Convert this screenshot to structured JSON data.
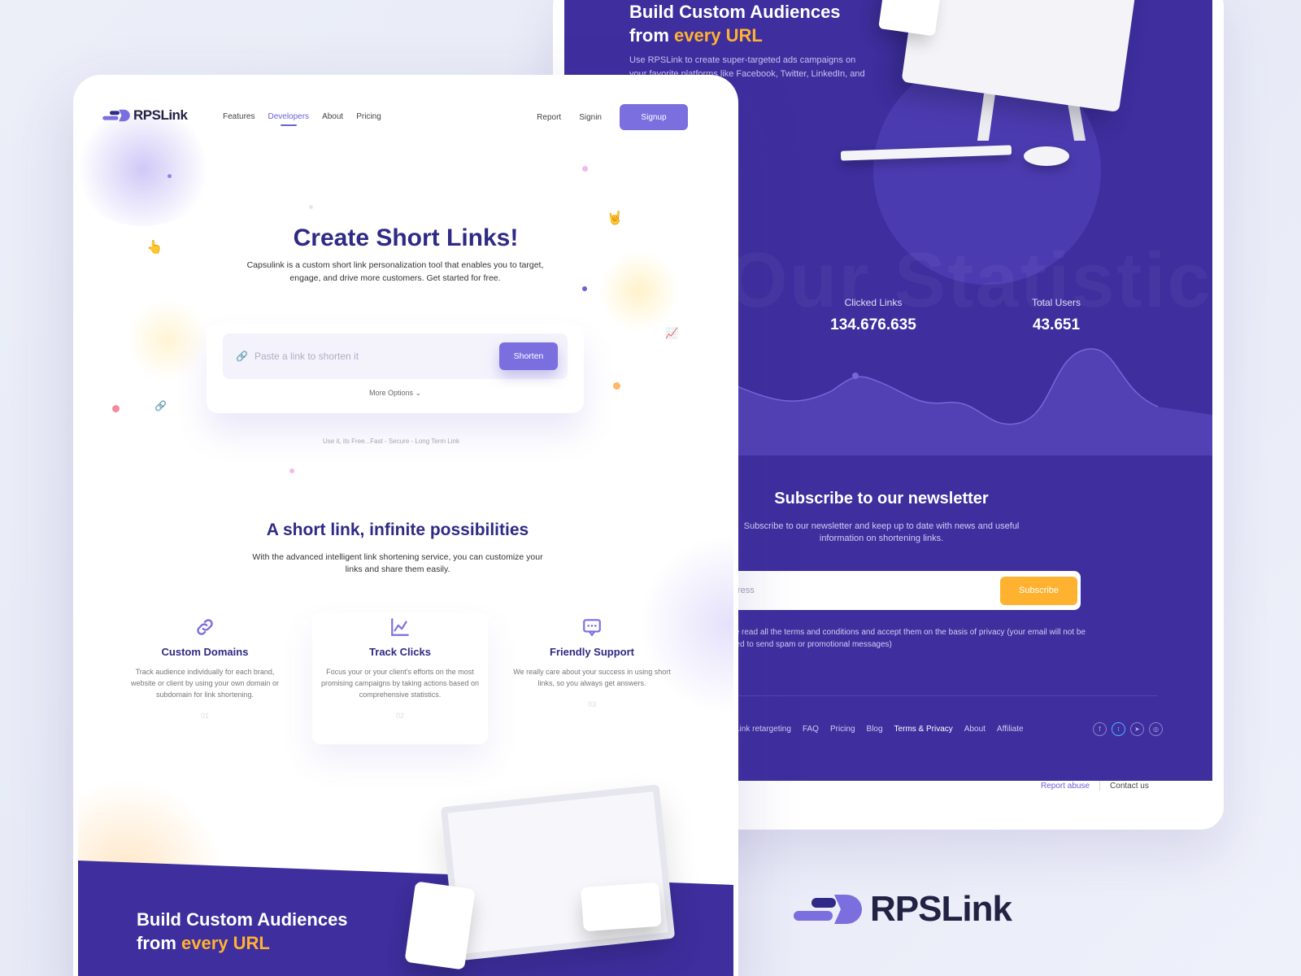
{
  "back": {
    "heading_line1": "Build Custom Audiences",
    "heading_line2_prefix": "from ",
    "heading_line2_accent": "every URL",
    "description": "Use  RPSLink to create super-targeted ads campaigns on your favorite platforms like Facebook, Twitter, LinkedIn, and boost your conversion",
    "watermark": "Our Statistics",
    "stats": [
      {
        "label": "Clicked Links",
        "value": "134.676.635"
      },
      {
        "label": "Total Users",
        "value": "43.651"
      }
    ],
    "newsletter": {
      "title": "Subscribe to our newsletter",
      "description": "Subscribe to our newsletter and keep up to date with news and useful information on shortening links.",
      "placeholder": "Email address",
      "button": "Subscribe",
      "terms": "I've read all the terms and conditions and accept them on the basis of privacy (your email will not be used to send spam or promotional messages)"
    },
    "footer_links": [
      "Link retargeting",
      "FAQ",
      "Pricing",
      "Blog",
      "Terms & Privacy",
      "About",
      "Affiliate"
    ],
    "footer_active": "Terms & Privacy",
    "social_icons": [
      "facebook-icon",
      "twitter-icon",
      "telegram-icon",
      "instagram-icon"
    ],
    "bottom_links": {
      "report": "Report abuse",
      "contact": "Contact us"
    }
  },
  "brand": {
    "name": "RPSLink",
    "accent": "#7b6fe0",
    "dark_purple": "#3e2e9e",
    "orange": "#ffb230",
    "title_color": "#2e2a85"
  },
  "front": {
    "nav": {
      "links": [
        "Features",
        "Developers",
        "About",
        "Pricing"
      ],
      "active": "Developers",
      "report": "Report",
      "signin": "Signin",
      "signup": "Signup"
    },
    "hero": {
      "title": "Create Short Links!",
      "description": "Capsulink is a custom short link personalization tool that enables you to target, engage, and drive more customers. Get started for free."
    },
    "shorten": {
      "placeholder": "Paste a link to shorten it",
      "button": "Shorten",
      "more_options": "More Options ⌄",
      "footnote": "Use it, its Free...Fast - Secure - Long Term Link"
    },
    "section": {
      "title": "A short link, infinite possibilities",
      "description": "With the advanced intelligent link shortening service, you can customize your links and share them easily."
    },
    "features": [
      {
        "icon": "link-icon",
        "title": "Custom Domains",
        "description": "Track audience individually for each brand, website or client by using your own domain or subdomain for link shortening.",
        "num": "01"
      },
      {
        "icon": "chart-icon",
        "title": "Track Clicks",
        "description": "Focus your or your client's efforts on the most promising campaigns by taking actions based on comprehensive statistics.",
        "num": "02"
      },
      {
        "icon": "chat-icon",
        "title": "Friendly Support",
        "description": "We really care about your success in using short links, so you always get answers.",
        "num": "03"
      }
    ],
    "bottom": {
      "heading_line1": "Build Custom Audiences",
      "heading_line2_prefix": "from ",
      "heading_line2_accent": "every URL"
    }
  }
}
